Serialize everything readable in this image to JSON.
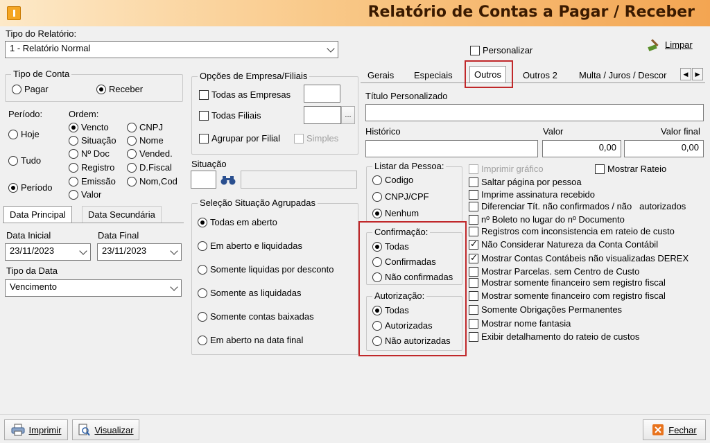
{
  "window": {
    "title": "Relatório de Contas a Pagar / Receber"
  },
  "report_type": {
    "label": "Tipo do Relatório:",
    "value": "1 - Relatório Normal"
  },
  "personalizar": {
    "label": "Personalizar",
    "checked": false
  },
  "limpar": {
    "label": "Limpar"
  },
  "account_type": {
    "title": "Tipo de Conta",
    "options": [
      "Pagar",
      "Receber"
    ],
    "selected": "Receber"
  },
  "period": {
    "title": "Período:",
    "options": [
      "Hoje",
      "Tudo",
      "Período"
    ],
    "selected": "Período"
  },
  "order": {
    "title": "Ordem:",
    "options": [
      "Vencto",
      "CNPJ",
      "Situação",
      "Nome",
      "Nº Doc",
      "Vended.",
      "Registro",
      "D.Fiscal",
      "Emissão",
      "Nom,Cod",
      "Valor"
    ],
    "selected": "Vencto"
  },
  "date_tabs": {
    "tabs": [
      "Data Principal",
      "Data Secundária"
    ],
    "active": "Data Principal"
  },
  "dates": {
    "start_label": "Data Inicial",
    "start_value": "23/11/2023",
    "end_label": "Data Final",
    "end_value": "23/11/2023",
    "type_label": "Tipo da Data",
    "type_value": "Vencimento"
  },
  "company": {
    "title": "Opções de Empresa/Filiais",
    "all_companies": "Todas as Empresas",
    "all_branches": "Todas Filiais",
    "browse": "...",
    "group_by_branch": "Agrupar por Filial",
    "simple": "Simples"
  },
  "situation": {
    "label": "Situação",
    "search_icon": "binoculars-icon"
  },
  "grouped_situation": {
    "title": "Seleção Situação Agrupadas",
    "options": [
      "Todas em aberto",
      "Em aberto e liquidadas",
      "Somente liquidas por desconto",
      "Somente as liquidadas",
      "Somente contas baixadas",
      "Em aberto na data final"
    ],
    "selected": "Todas em aberto"
  },
  "tabs": {
    "items": [
      "Gerais",
      "Especiais",
      "Outros",
      "Outros 2",
      "Multa / Juros / Descor"
    ],
    "active": "Outros"
  },
  "custom_title": {
    "label": "Título Personalizado",
    "value": ""
  },
  "history": {
    "label": "Histórico",
    "value": ""
  },
  "value": {
    "label": "Valor",
    "value": "0,00"
  },
  "final_value": {
    "label": "Valor final",
    "value": "0,00"
  },
  "person_list": {
    "title": "Listar da Pessoa:",
    "options": [
      "Codigo",
      "CNPJ/CPF",
      "Nenhum"
    ],
    "selected": "Nenhum"
  },
  "confirmation": {
    "title": "Confirmação:",
    "options": [
      "Todas",
      "Confirmadas",
      "Não confirmadas"
    ],
    "selected": "Todas"
  },
  "authorization": {
    "title": "Autorização:",
    "options": [
      "Todas",
      "Autorizadas",
      "Não autorizadas"
    ],
    "selected": "Todas"
  },
  "options": {
    "print_chart": "Imprimir gráfico",
    "show_rateio": "Mostrar Rateio",
    "items": [
      {
        "label": "Saltar página por pessoa",
        "checked": false
      },
      {
        "label": "Imprime assinatura recebido",
        "checked": false
      },
      {
        "label": "Diferenciar Tít. não confirmados / não   autorizados",
        "checked": false
      },
      {
        "label": "nº Boleto no lugar do nº Documento",
        "checked": false
      },
      {
        "label": "Registros com inconsistencia em rateio de custo",
        "checked": false
      },
      {
        "label": "Não Considerar Natureza da Conta Contábil",
        "checked": true
      },
      {
        "label": "Mostrar Contas Contábeis não visualizadas DEREX",
        "checked": true
      },
      {
        "label": "Mostrar Parcelas. sem Centro de Custo",
        "checked": false
      },
      {
        "label": "Mostrar somente financeiro sem registro fiscal",
        "checked": false
      },
      {
        "label": "Mostrar somente financeiro com registro fiscal",
        "checked": false
      },
      {
        "label": "Somente Obrigações Permanentes",
        "checked": false
      },
      {
        "label": "Mostrar nome fantasia",
        "checked": false
      },
      {
        "label": "Exibir detalhamento do rateio de custos",
        "checked": false
      }
    ]
  },
  "footer": {
    "print": "Imprimir",
    "preview": "Visualizar",
    "close": "Fechar"
  },
  "colors": {
    "highlight": "#c0282a",
    "title_text": "#3a1a00"
  }
}
